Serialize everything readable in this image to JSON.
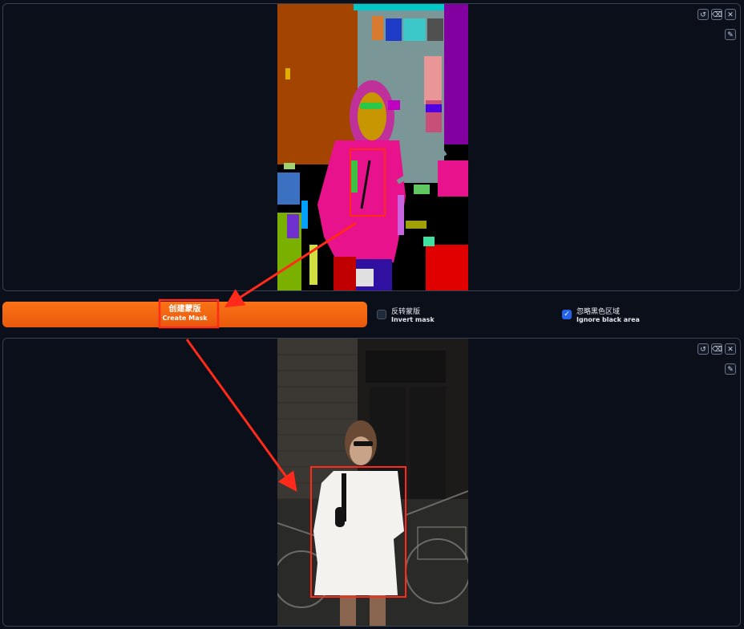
{
  "top_panel": {
    "icons": [
      "undo-icon",
      "clear-icon",
      "close-icon",
      "brush-icon"
    ]
  },
  "controls": {
    "create_mask_label_zh": "创建蒙版",
    "create_mask_label_en": "Create Mask",
    "invert_mask_zh": "反转蒙版",
    "invert_mask_en": "Invert mask",
    "invert_mask_checked": false,
    "ignore_black_zh": "忽略黑色区域",
    "ignore_black_en": "Ignore black area",
    "ignore_black_checked": true
  },
  "bottom_panel": {
    "icons": [
      "undo-icon",
      "clear-icon",
      "close-icon",
      "brush-icon"
    ]
  },
  "colors": {
    "accent": "#f97316",
    "annotation": "#ff2a1a",
    "checkbox": "#2563eb",
    "background": "#0b0f19"
  }
}
